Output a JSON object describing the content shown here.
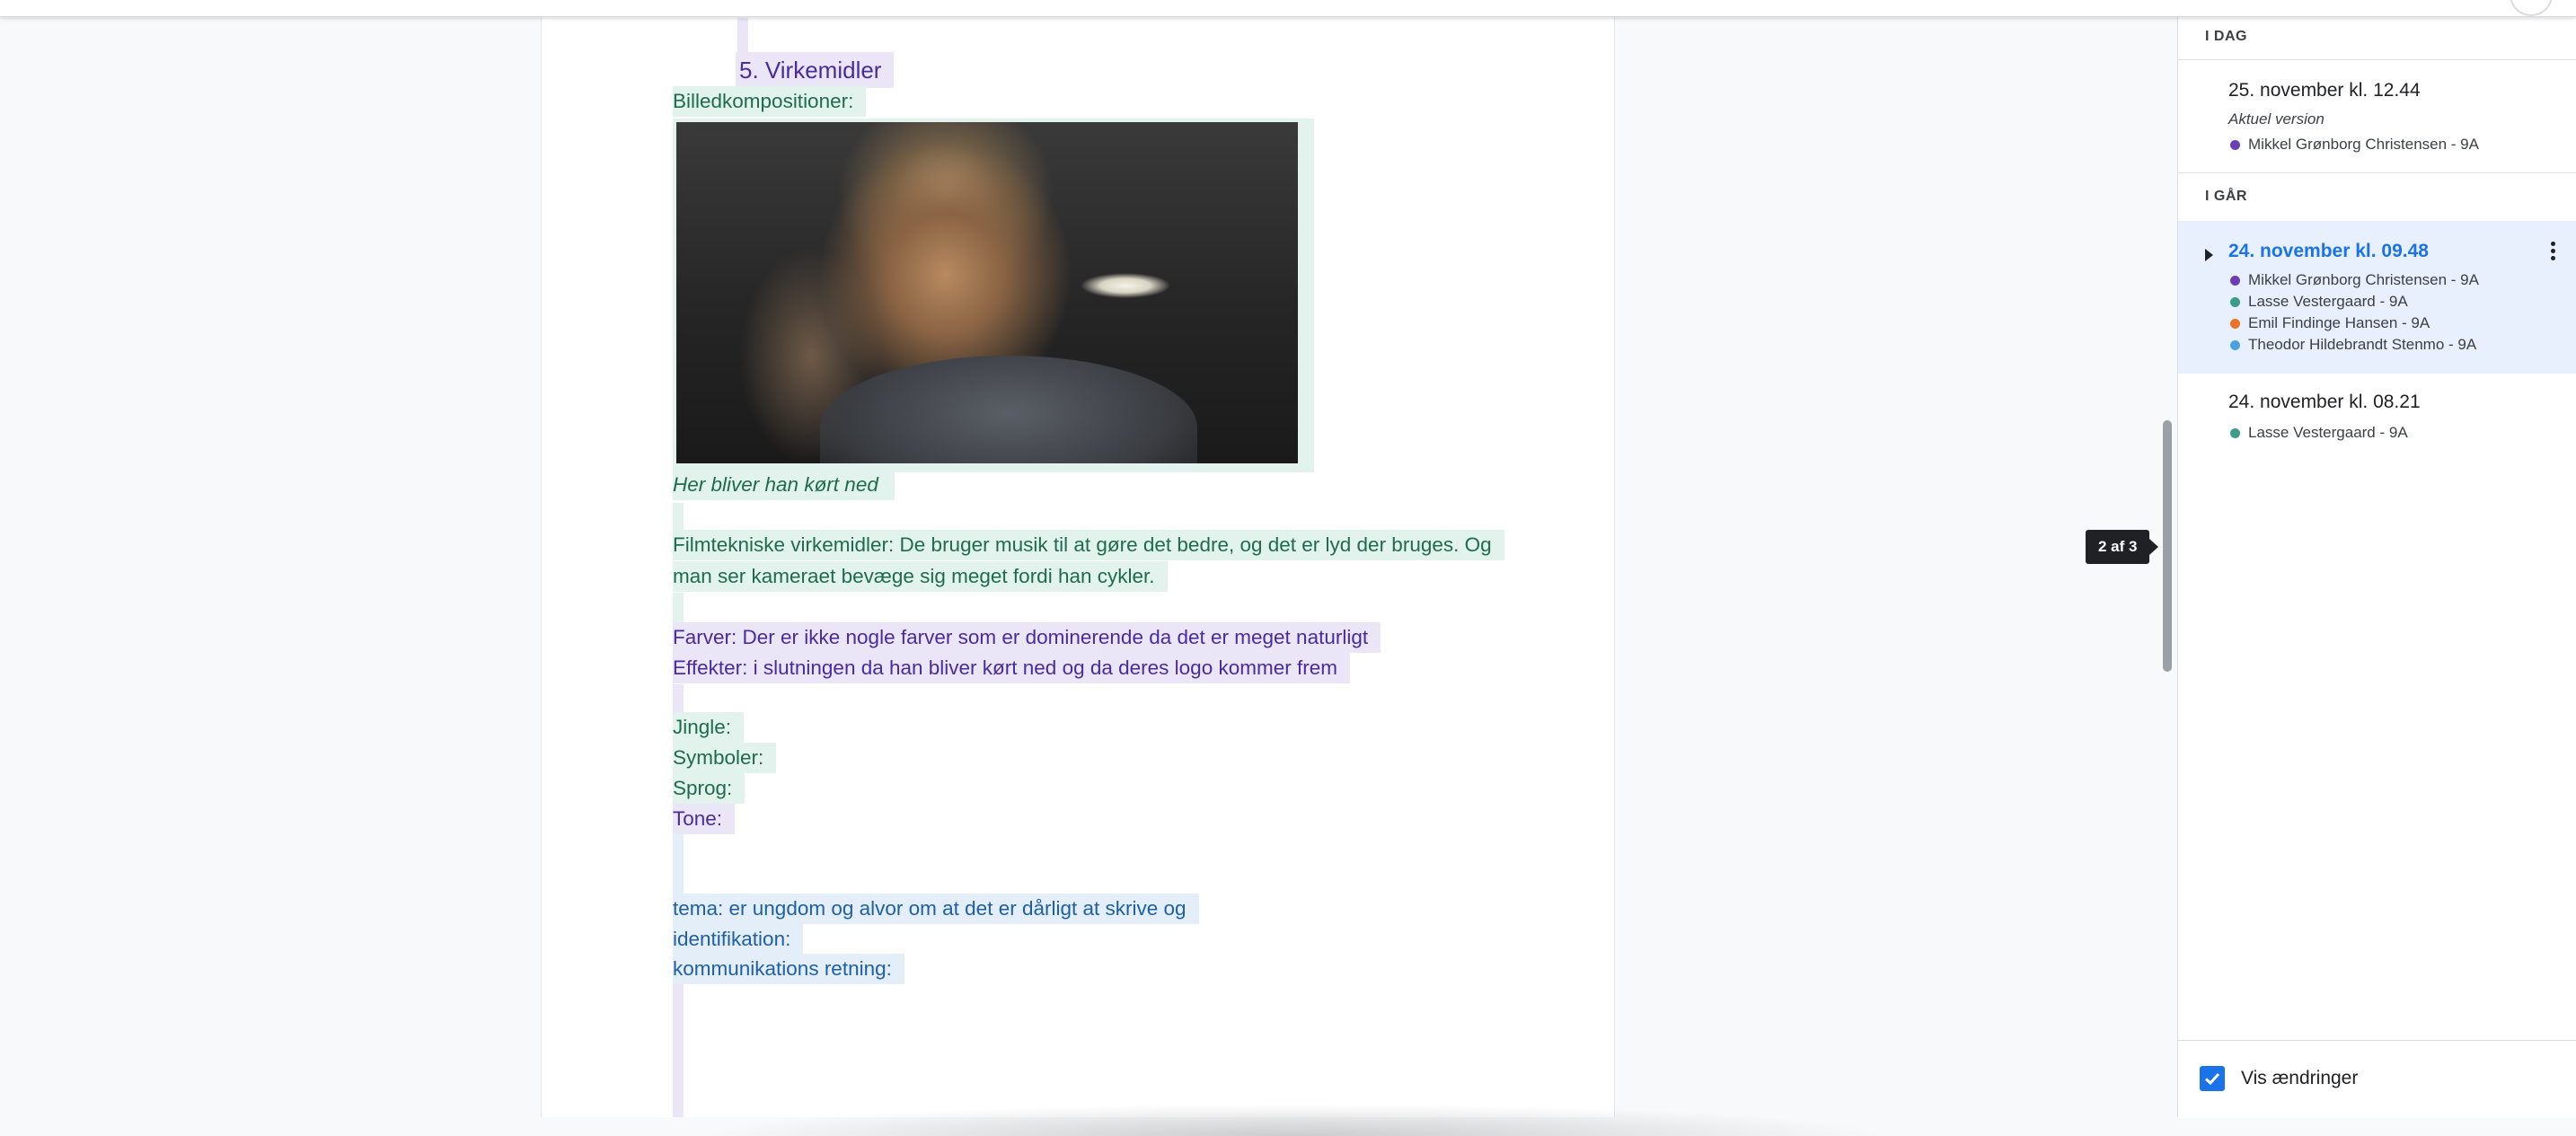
{
  "document": {
    "heading": "5. Virkemidler",
    "lines": {
      "billedkomp": "Billedkompositioner:",
      "caption": "Her bliver han kørt ned",
      "film1": "Filmtekniske virkemidler: De bruger musik til at gøre det bedre, og det er lyd der bruges. Og",
      "film2": "man ser kameraet bevæge sig meget fordi han cykler.",
      "farver": "Farver: Der er ikke nogle farver som er dominerende da det er meget naturligt",
      "effekter": "Effekter: i slutningen da han bliver kørt ned og da deres logo kommer frem",
      "jingle": "Jingle:",
      "symboler": "Symboler:",
      "sprog": "Sprog:",
      "tone": "Tone:",
      "tema": "tema: er ungdom og alvor om at det er dårligt at skrive og",
      "identifikation": "identifikation:",
      "kommunikation": "kommunikations retning:"
    }
  },
  "page_counter": "2 af 3",
  "version_history": {
    "today_label": "I DAG",
    "yesterday_label": "I GÅR",
    "versions": [
      {
        "title": "25. november kl. 12.44",
        "subtitle": "Aktuel version",
        "authors": [
          {
            "name": "Mikkel Grønborg Christensen - 9A",
            "color": "#6a3fb5"
          }
        ]
      },
      {
        "title": "24. november kl. 09.48",
        "selected": true,
        "authors": [
          {
            "name": "Mikkel Grønborg Christensen - 9A",
            "color": "#6a3fb5"
          },
          {
            "name": "Lasse Vestergaard - 9A",
            "color": "#3a9d8a"
          },
          {
            "name": "Emil Findinge Hansen - 9A",
            "color": "#e8742a"
          },
          {
            "name": "Theodor Hildebrandt Stenmo - 9A",
            "color": "#4aa3e0"
          }
        ]
      },
      {
        "title": "24. november kl. 08.21",
        "authors": [
          {
            "name": "Lasse Vestergaard - 9A",
            "color": "#3a9d8a"
          }
        ]
      }
    ]
  },
  "footer": {
    "show_changes_label": "Vis ændringer",
    "show_changes_checked": true,
    "accent": "#1a73e8"
  }
}
